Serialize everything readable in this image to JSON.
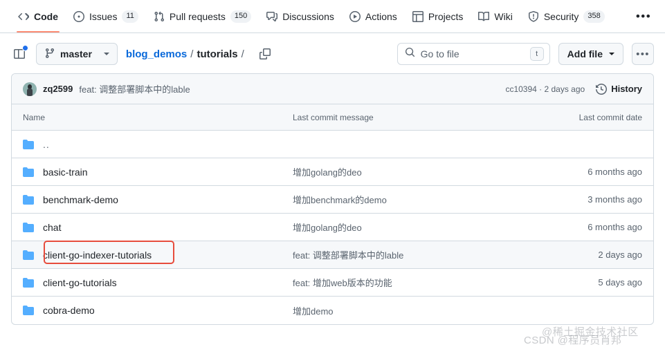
{
  "nav": {
    "tabs": [
      {
        "label": "Code",
        "icon": "code-icon",
        "count": null,
        "active": true
      },
      {
        "label": "Issues",
        "icon": "issue-icon",
        "count": "11",
        "active": false
      },
      {
        "label": "Pull requests",
        "icon": "pull-request-icon",
        "count": "150",
        "active": false
      },
      {
        "label": "Discussions",
        "icon": "comment-icon",
        "count": null,
        "active": false
      },
      {
        "label": "Actions",
        "icon": "play-icon",
        "count": null,
        "active": false
      },
      {
        "label": "Projects",
        "icon": "table-icon",
        "count": null,
        "active": false
      },
      {
        "label": "Wiki",
        "icon": "book-icon",
        "count": null,
        "active": false
      },
      {
        "label": "Security",
        "icon": "shield-icon",
        "count": "358",
        "active": false
      }
    ],
    "more_label": "•••"
  },
  "toolbar": {
    "sidebar_toggle_icon": "sidebar-expand-icon",
    "branch": "master",
    "breadcrumb": {
      "repo": "blog_demos",
      "separator": "/",
      "current": "tutorials",
      "trailing_separator": "/"
    },
    "copy_path_icon": "copy-icon",
    "search": {
      "placeholder": "Go to file",
      "value": "",
      "shortcut": "t",
      "icon": "search-icon"
    },
    "add_file_label": "Add file",
    "kebab_label": "•••"
  },
  "commit_bar": {
    "author": "zq2599",
    "message": "feat: 调整部署脚本中的lable",
    "hash_and_time": "cc10394 · 2 days ago",
    "history_label": "History",
    "history_icon": "history-icon"
  },
  "table": {
    "headers": {
      "name": "Name",
      "message": "Last commit message",
      "date": "Last commit date"
    },
    "rows": [
      {
        "name": "..",
        "icon": "folder-icon",
        "message": "",
        "date": "",
        "highlighted": false,
        "parent": true
      },
      {
        "name": "basic-train",
        "icon": "folder-icon",
        "message": "增加golang的deo",
        "date": "6 months ago",
        "highlighted": false,
        "parent": false
      },
      {
        "name": "benchmark-demo",
        "icon": "folder-icon",
        "message": "增加benchmark的demo",
        "date": "3 months ago",
        "highlighted": false,
        "parent": false
      },
      {
        "name": "chat",
        "icon": "folder-icon",
        "message": "增加golang的deo",
        "date": "6 months ago",
        "highlighted": false,
        "parent": false
      },
      {
        "name": "client-go-indexer-tutorials",
        "icon": "folder-icon",
        "message": "feat: 调整部署脚本中的lable",
        "date": "2 days ago",
        "highlighted": true,
        "parent": false
      },
      {
        "name": "client-go-tutorials",
        "icon": "folder-icon",
        "message": "feat: 增加web版本的功能",
        "date": "5 days ago",
        "highlighted": false,
        "parent": false
      },
      {
        "name": "cobra-demo",
        "icon": "folder-icon",
        "message": "增加demo",
        "date": "",
        "highlighted": false,
        "parent": false
      }
    ]
  },
  "watermarks": {
    "primary": "@稀土掘金技术社区",
    "secondary": "CSDN @程序员肖邦"
  },
  "colors": {
    "accent": "#0969da",
    "active_tab_underline": "#fd8c73",
    "folder": "#54aeff",
    "annotation": "#e74c3c",
    "border": "#d1d9e0",
    "surface": "#f6f8fa"
  }
}
